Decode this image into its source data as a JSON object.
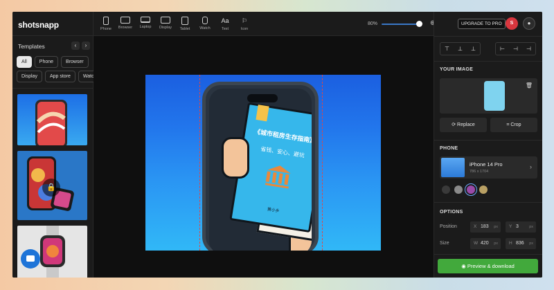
{
  "app": {
    "logo": "shotsnapp"
  },
  "templates": {
    "title": "Templates",
    "prev_label": "‹",
    "next_label": "›",
    "chips": [
      "All",
      "Phone",
      "Browser",
      "Te"
    ],
    "chips_row2": [
      "Display",
      "App store",
      "Watch"
    ],
    "lock_icon": "🔒"
  },
  "toolbar": {
    "tools": [
      {
        "label": "Phone",
        "icon": "phone-icon"
      },
      {
        "label": "Browser",
        "icon": "browser-icon"
      },
      {
        "label": "Laptop",
        "icon": "laptop-icon"
      },
      {
        "label": "Display",
        "icon": "display-icon"
      },
      {
        "label": "Tablet",
        "icon": "tablet-icon"
      },
      {
        "label": "Watch",
        "icon": "watch-icon"
      },
      {
        "label": "Text",
        "icon": "text-icon"
      },
      {
        "label": "Icon",
        "icon": "icon-icon"
      }
    ],
    "zoom": "80%",
    "zoom_value": 0.8,
    "zoom_plus": "⊕"
  },
  "canvas": {
    "book_title": "《城市租房生存指南》",
    "book_subtitle": "省钱、安心、避坑",
    "book_author": "黄小乡"
  },
  "right": {
    "upgrade": "UPGRADE TO PRO",
    "badge": "S",
    "user_icon": "user-icon",
    "align_buttons_1": [
      "⊤",
      "⊥",
      "⊥"
    ],
    "align_buttons_2": [
      "⊢",
      "⊣",
      "⊣"
    ],
    "your_image_title": "YOUR IMAGE",
    "trash_icon": "🗑",
    "replace_label": "⟳ Replace",
    "crop_label": "⌗ Crop",
    "phone_title": "PHONE",
    "phone_name": "iPhone 14 Pro",
    "phone_dims": "786 x 1704",
    "phone_chevron": "›",
    "swatches": [
      "#3a3a3a",
      "#8a8a8a",
      "#9a4aa8",
      "#b9a064"
    ],
    "options_title": "OPTIONS",
    "position_label": "Position",
    "size_label": "Size",
    "pos_x_key": "X",
    "pos_x": "183",
    "pos_x_unit": "px",
    "pos_y_key": "Y",
    "pos_y": "3",
    "pos_y_unit": "px",
    "size_w_key": "W",
    "size_w": "420",
    "size_w_unit": "px",
    "size_h_key": "H",
    "size_h": "836",
    "size_h_unit": "px",
    "preview_label": "◉ Preview & download"
  }
}
